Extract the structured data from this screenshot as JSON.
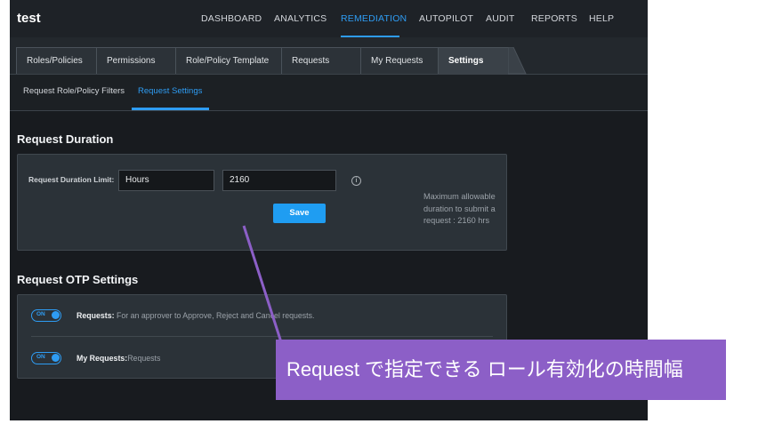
{
  "app": {
    "title": "test"
  },
  "nav": {
    "items": [
      "DASHBOARD",
      "ANALYTICS",
      "REMEDIATION",
      "AUTOPILOT",
      "AUDIT",
      "REPORTS",
      "HELP"
    ],
    "active": "REMEDIATION"
  },
  "tabs": {
    "items": [
      "Roles/Policies",
      "Permissions",
      "Role/Policy Template",
      "Requests",
      "My Requests",
      "Settings"
    ],
    "active": "Settings"
  },
  "subtabs": {
    "items": [
      "Request Role/Policy Filters",
      "Request Settings"
    ],
    "active": "Request Settings"
  },
  "request_duration": {
    "title": "Request Duration",
    "limit_label": "Request Duration Limit:",
    "unit_value": "Hours",
    "amount_value": "2160",
    "info_icon": "i",
    "save_label": "Save",
    "help_text": "Maximum allowable duration to submit a request : 2160 hrs"
  },
  "otp": {
    "title": "Request OTP Settings",
    "rows": [
      {
        "toggle": "ON",
        "label": "Requests:",
        "desc": " For an approver to Approve, Reject and Cancel requests."
      },
      {
        "toggle": "ON",
        "label": "My Requests:",
        "desc": "Requests"
      }
    ]
  },
  "annotation": {
    "text": "Request で指定できる ロール有効化の時間幅"
  },
  "colors": {
    "accent": "#2e9cf3",
    "annotation_bg": "#8c5fc7",
    "background": "#181b1f"
  }
}
